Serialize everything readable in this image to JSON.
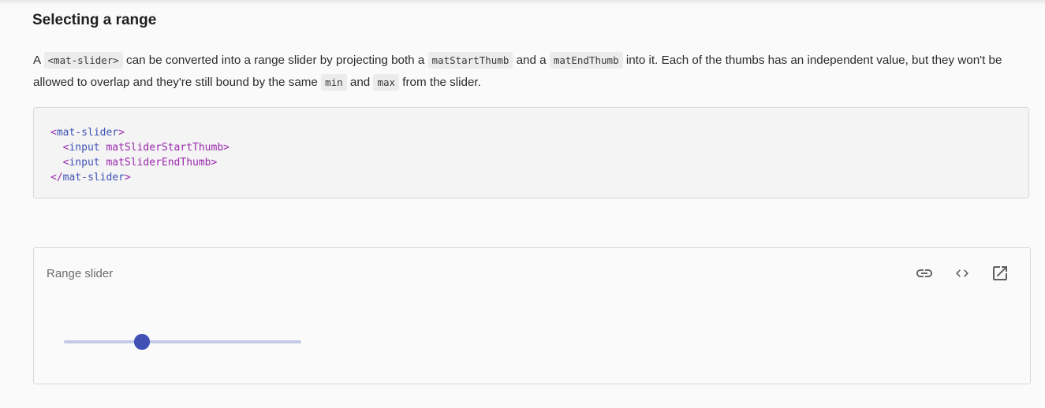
{
  "section": {
    "heading": "Selecting a range",
    "paragraph": [
      "A ",
      "<mat-slider>",
      " can be converted into a range slider by projecting both a ",
      "matStartThumb",
      " and a ",
      "matEndThumb",
      " into it. Each of the thumbs has an independent value, but they won't be allowed to overlap and they're still bound by the same ",
      "min",
      " and ",
      "max",
      " from the slider."
    ]
  },
  "code_sample": {
    "lines": [
      {
        "open": "<",
        "name": "mat-slider",
        "attr": "",
        "close": ">"
      },
      {
        "open": "  <",
        "name": "input",
        "attr": " matSliderStartThumb",
        "close": ">"
      },
      {
        "open": "  <",
        "name": "input",
        "attr": " matSliderEndThumb",
        "close": ">"
      },
      {
        "open": "</",
        "name": "mat-slider",
        "attr": "",
        "close": ">"
      }
    ]
  },
  "example": {
    "title": "Range slider",
    "actions": [
      {
        "icon": "link-icon",
        "name": "copy-link-button"
      },
      {
        "icon": "code-icon",
        "name": "view-code-button"
      },
      {
        "icon": "open-in-new-icon",
        "name": "open-stackblitz-button"
      }
    ],
    "slider": {
      "start_value": 0.33,
      "end_value": 0.33,
      "accent_color": "#3f51b5",
      "track_color": "#c5cae9"
    }
  }
}
